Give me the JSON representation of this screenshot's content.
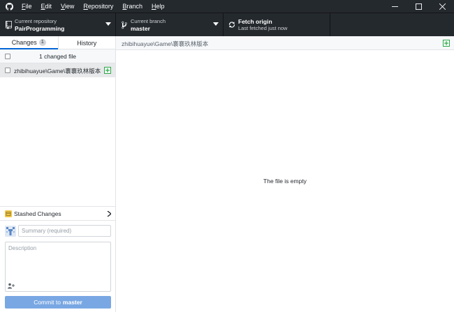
{
  "menu": {
    "items": [
      {
        "label": "File",
        "u": "F",
        "rest": "ile"
      },
      {
        "label": "Edit",
        "u": "E",
        "rest": "dit"
      },
      {
        "label": "View",
        "u": "V",
        "rest": "iew"
      },
      {
        "label": "Repository",
        "u": "R",
        "rest": "epository"
      },
      {
        "label": "Branch",
        "u": "B",
        "rest": "ranch"
      },
      {
        "label": "Help",
        "u": "H",
        "rest": "elp"
      }
    ]
  },
  "toolbar": {
    "repo_label": "Current repository",
    "repo_value": "PairProgramming",
    "branch_label": "Current branch",
    "branch_value": "master",
    "fetch_title": "Fetch origin",
    "fetch_sub": "Last fetched just now"
  },
  "sidebar": {
    "tab_changes": "Changes",
    "tab_changes_count": "1",
    "tab_history": "History",
    "changed_header": "1 changed file",
    "files": [
      {
        "name": "zhibihuayue\\Game\\褰褰玖林版本"
      }
    ],
    "stash_label": "Stashed Changes",
    "summary_placeholder": "Summary (required)",
    "description_placeholder": "Description",
    "commit_prefix": "Commit to",
    "commit_branch": "master"
  },
  "main": {
    "path": "zhibihuayue\\Game\\褰褰玖林版本",
    "empty_message": "The file is empty"
  },
  "colors": {
    "titlebar_bg": "#24292e",
    "accent": "#0366d6",
    "commit_button": "#79a7e3",
    "added_green": "#28a745"
  }
}
